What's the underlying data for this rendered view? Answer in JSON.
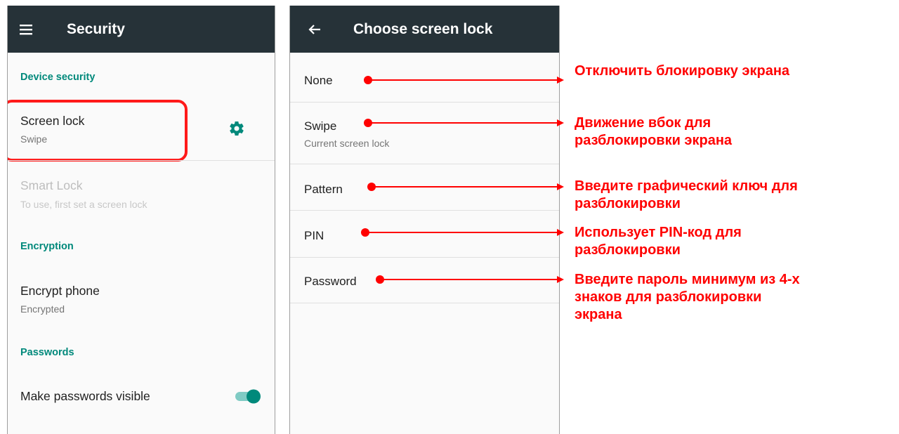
{
  "security_screen": {
    "title": "Security",
    "device_security_header": "Device security",
    "screen_lock_title": "Screen lock",
    "screen_lock_value": "Swipe",
    "smart_lock_title": "Smart Lock",
    "smart_lock_sub": "To use, first set a screen lock",
    "encryption_header": "Encryption",
    "encrypt_phone_title": "Encrypt phone",
    "encrypt_phone_value": "Encrypted",
    "passwords_header": "Passwords",
    "make_passwords_visible_title": "Make passwords visible",
    "make_passwords_visible_on": true
  },
  "choose_lock_screen": {
    "title": "Choose screen lock",
    "options": [
      {
        "label": "None",
        "sub": ""
      },
      {
        "label": "Swipe",
        "sub": "Current screen lock"
      },
      {
        "label": "Pattern",
        "sub": ""
      },
      {
        "label": "PIN",
        "sub": ""
      },
      {
        "label": "Password",
        "sub": ""
      }
    ]
  },
  "annotations": {
    "none": [
      "Отключить блокировку экрана"
    ],
    "swipe": [
      "Движение вбок для",
      "разблокировки экрана"
    ],
    "pattern": [
      "Введите графический ключ для",
      "разблокировки"
    ],
    "pin": [
      "Использует PIN-код для",
      "разблокировки"
    ],
    "password": [
      "Введите пароль минимум из 4-х",
      "знаков для разблокировки",
      "экрана"
    ]
  },
  "colors": {
    "appbar": "#263238",
    "accent": "#00897b",
    "highlight": "#ff1a1a",
    "annotation": "#ff0000"
  },
  "icons": {
    "menu": "hamburger-menu-icon",
    "back": "back-arrow-icon",
    "settings": "gear-icon"
  }
}
